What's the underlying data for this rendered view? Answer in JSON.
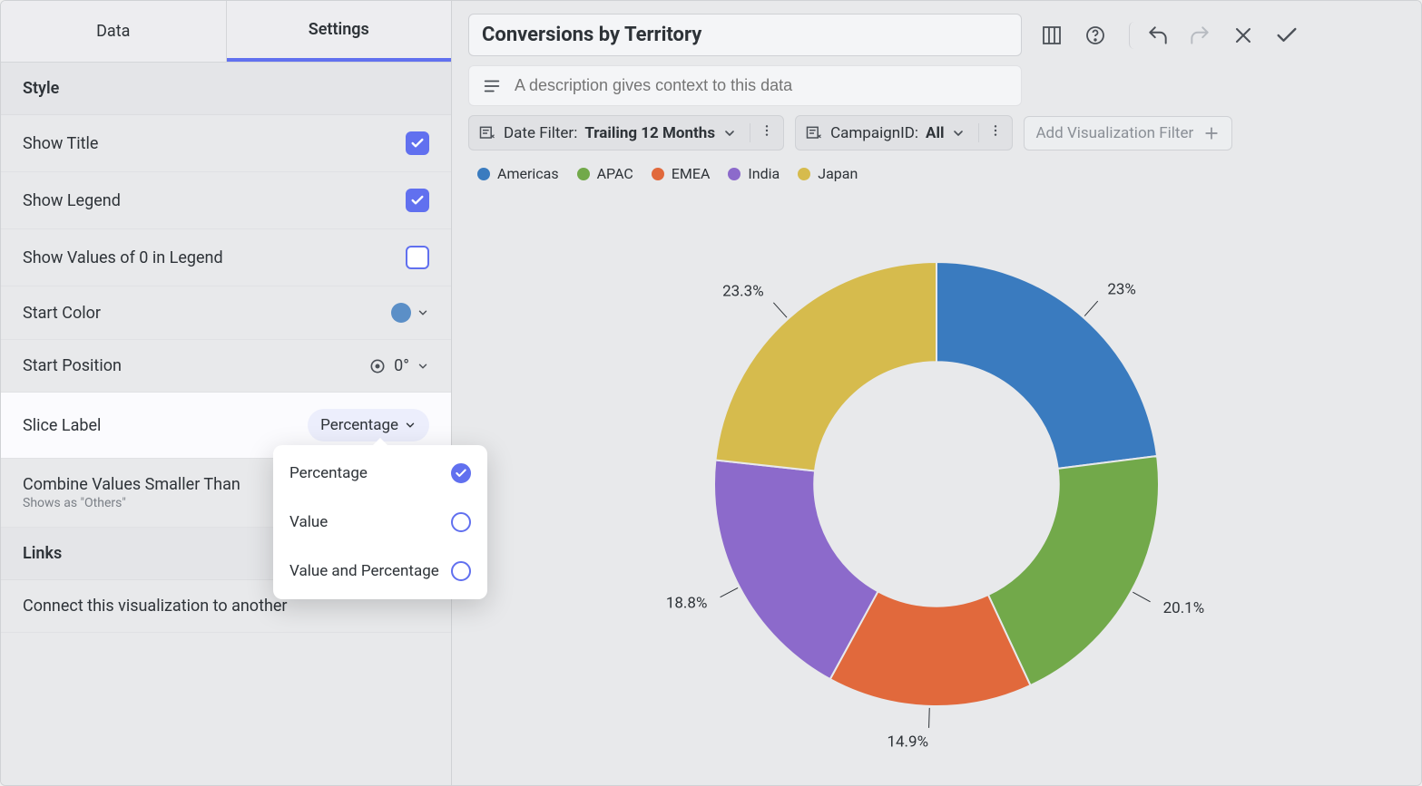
{
  "tabs": {
    "data": "Data",
    "settings": "Settings",
    "active": "settings"
  },
  "sections": {
    "style": "Style",
    "links": "Links"
  },
  "settings": {
    "showTitle": {
      "label": "Show Title",
      "value": true
    },
    "showLegend": {
      "label": "Show Legend",
      "value": true
    },
    "showZero": {
      "label": "Show Values of 0 in Legend",
      "value": false
    },
    "startColor": {
      "label": "Start Color",
      "value": "#5b8fc7"
    },
    "startPosition": {
      "label": "Start Position",
      "value": "0°"
    },
    "sliceLabel": {
      "label": "Slice Label",
      "value": "Percentage"
    },
    "combine": {
      "label": "Combine Values Smaller Than",
      "hint": "Shows as \"Others\""
    },
    "connect": {
      "label": "Connect this visualization to another"
    }
  },
  "sliceLabelOptions": {
    "percentage": "Percentage",
    "value": "Value",
    "valueAndPercentage": "Value and Percentage"
  },
  "header": {
    "title": "Conversions by Territory",
    "descriptionPlaceholder": "A description gives context to this data"
  },
  "filters": {
    "date": {
      "icon": "filter",
      "label": "Date Filter:",
      "value": "Trailing 12 Months"
    },
    "campaign": {
      "icon": "filter",
      "label": "CampaignID:",
      "value": "All"
    },
    "add": "Add Visualization Filter"
  },
  "legend": [
    {
      "name": "Americas",
      "color": "#3a7bbf"
    },
    {
      "name": "APAC",
      "color": "#72a94a"
    },
    {
      "name": "EMEA",
      "color": "#e1693c"
    },
    {
      "name": "India",
      "color": "#8c6acb"
    },
    {
      "name": "Japan",
      "color": "#d6bb4d"
    }
  ],
  "chart_data": {
    "type": "pie",
    "subtype": "donut",
    "title": "Conversions by Territory",
    "categories": [
      "Americas",
      "APAC",
      "EMEA",
      "India",
      "Japan"
    ],
    "values": [
      23.0,
      20.1,
      14.9,
      18.8,
      23.3
    ],
    "unit": "percent",
    "colors": [
      "#3a7bbf",
      "#72a94a",
      "#e1693c",
      "#8c6acb",
      "#d6bb4d"
    ],
    "start_angle_deg": 0,
    "inner_radius_ratio": 0.55,
    "label_suffix": "%",
    "legend_position": "top"
  }
}
